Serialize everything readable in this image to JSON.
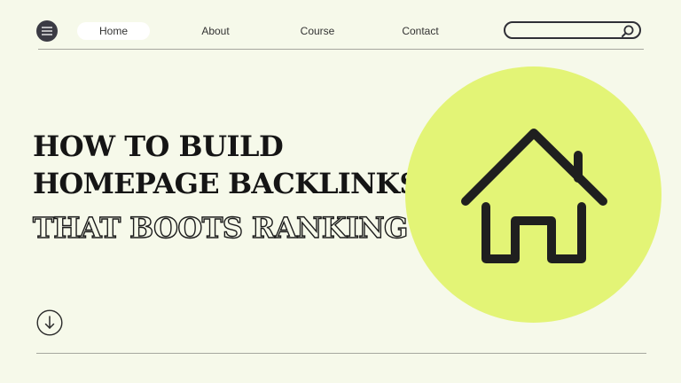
{
  "nav": {
    "items": [
      {
        "label": "Home",
        "active": true
      },
      {
        "label": "About",
        "active": false
      },
      {
        "label": "Course",
        "active": false
      },
      {
        "label": "Contact",
        "active": false
      }
    ]
  },
  "search": {
    "value": "",
    "placeholder": ""
  },
  "headline": {
    "line1": "HOW TO BUILD",
    "line2": "HOMEPAGE BACKLINKS",
    "line3": "THAT BOOTS RANKING"
  },
  "icons": {
    "menu": "hamburger-menu-icon",
    "search": "search-icon",
    "scroll": "arrow-down-circle-icon",
    "hero": "house-icon"
  },
  "colors": {
    "background": "#f6f9ea",
    "accent_circle": "#e3f476",
    "ink": "#1c1c1c",
    "active_pill": "#ffffff"
  }
}
